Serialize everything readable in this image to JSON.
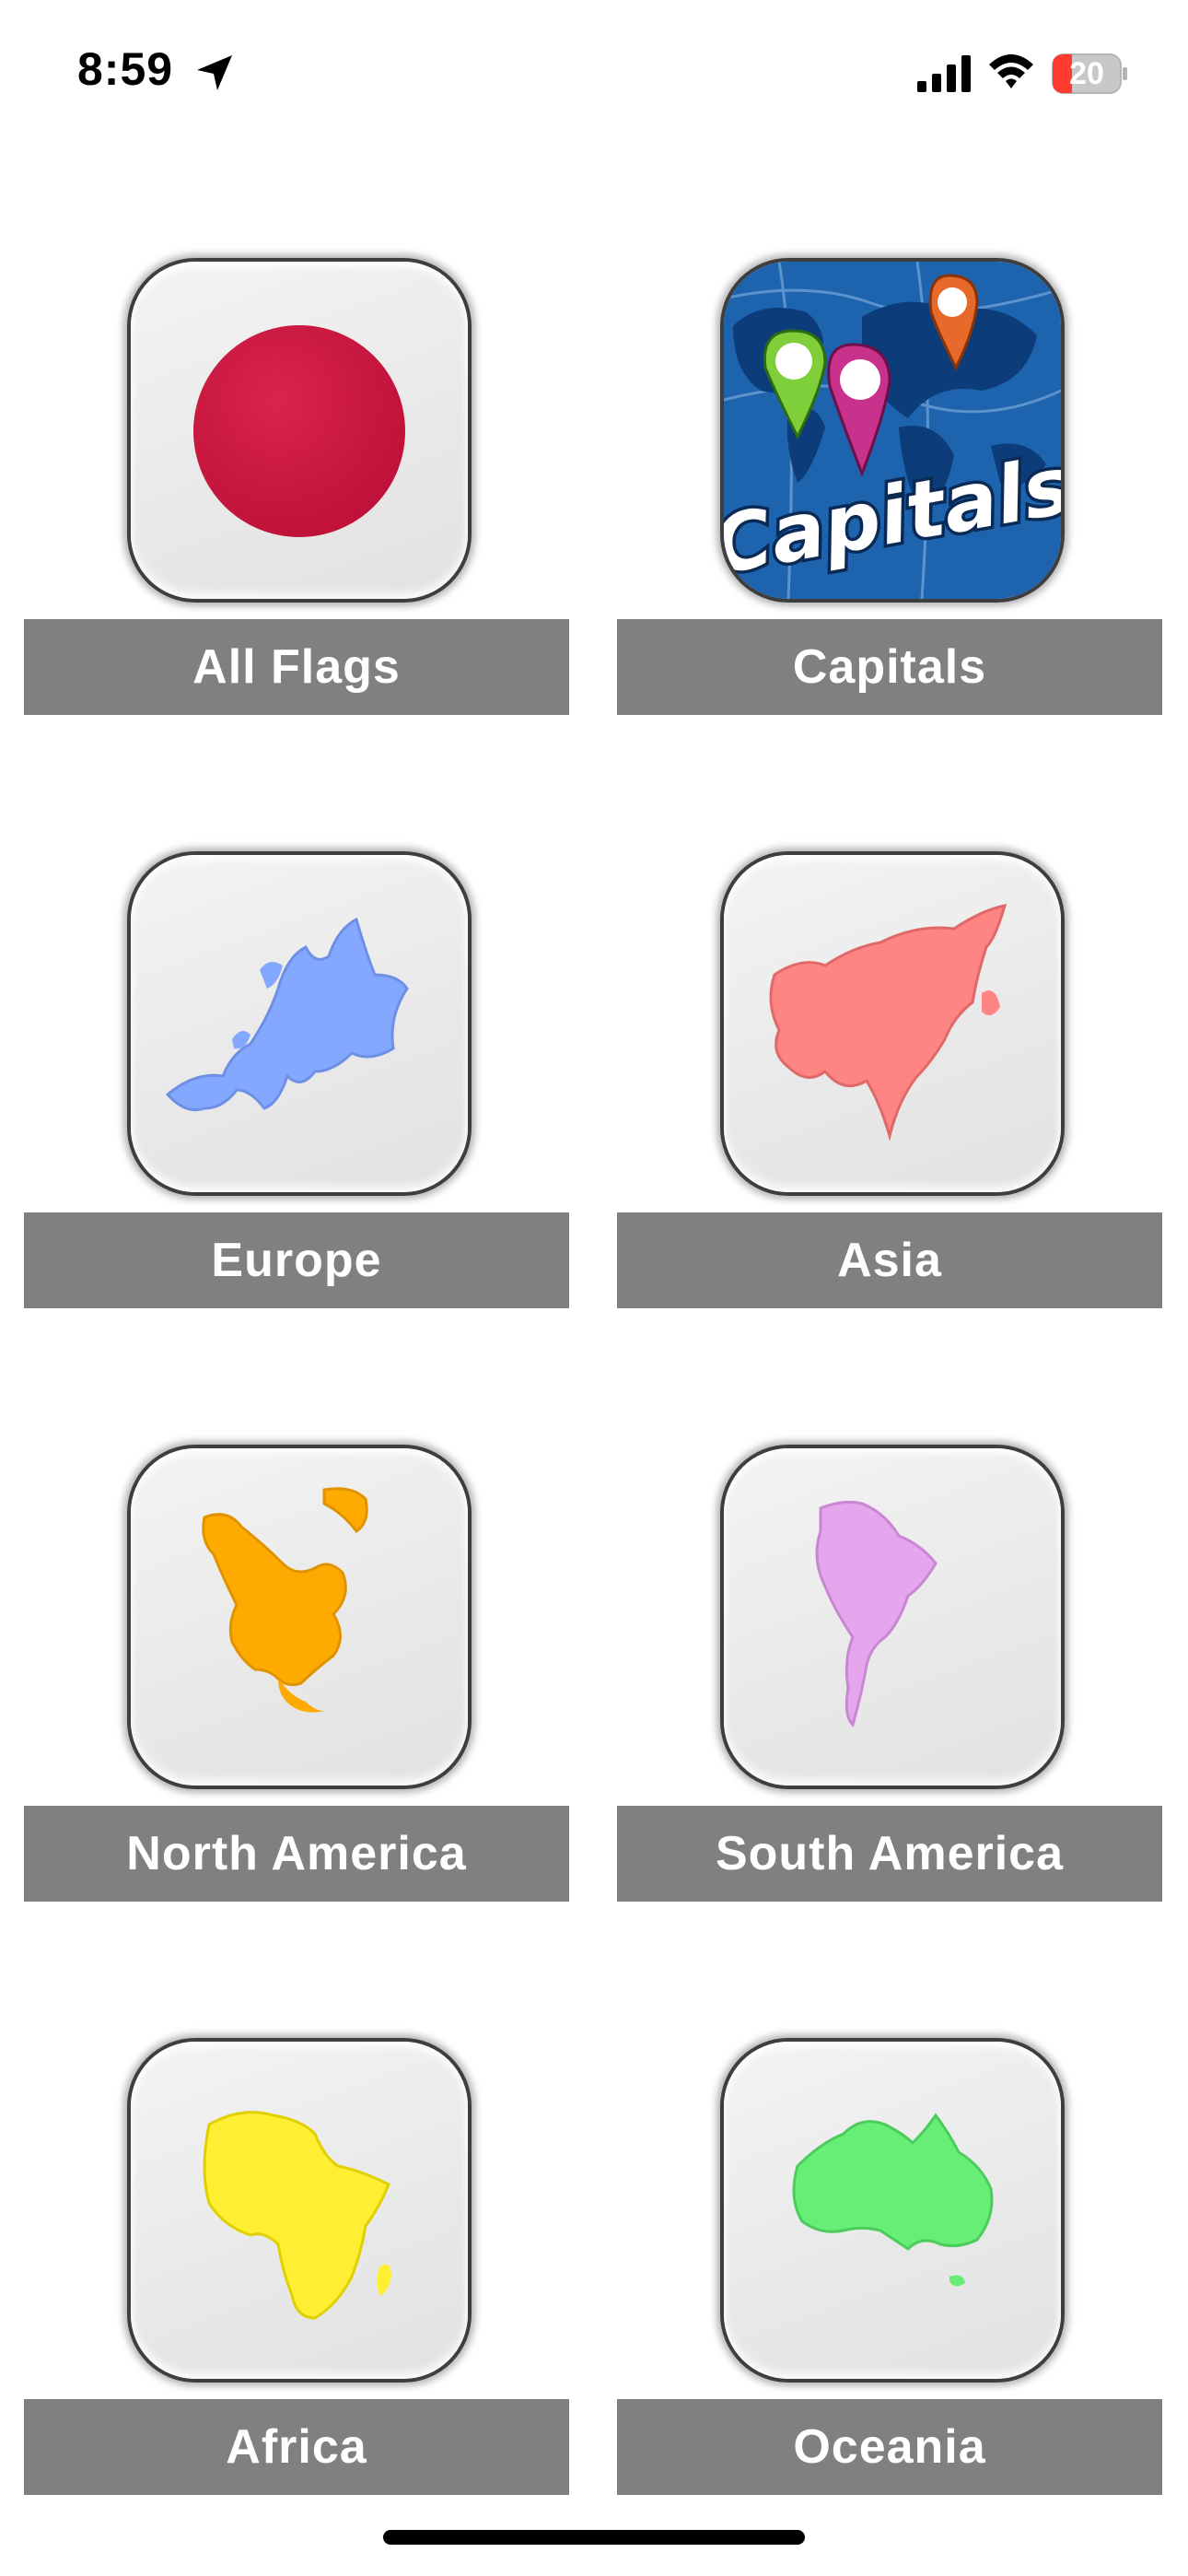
{
  "status_bar": {
    "time": "8:59",
    "battery_level": "20",
    "icons": [
      "location-arrow-icon",
      "cellular-signal-icon",
      "wifi-icon",
      "battery-icon"
    ],
    "battery_color": "#ff3b30"
  },
  "categories": [
    {
      "label": "All Flags",
      "icon": "japan-flag-icon",
      "color": "#c8163e"
    },
    {
      "label": "Capitals",
      "icon": "capitals-map-icon",
      "color": "#1b5ea6"
    },
    {
      "label": "Europe",
      "icon": "europe-map-icon",
      "color": "#85a8ff"
    },
    {
      "label": "Asia",
      "icon": "asia-map-icon",
      "color": "#ff8585"
    },
    {
      "label": "North America",
      "icon": "north-america-map-icon",
      "color": "#ffaa00"
    },
    {
      "label": "South America",
      "icon": "south-america-map-icon",
      "color": "#e6a6ee"
    },
    {
      "label": "Africa",
      "icon": "africa-map-icon",
      "color": "#ffef33"
    },
    {
      "label": "Oceania",
      "icon": "oceania-map-icon",
      "color": "#66ee77"
    }
  ],
  "capitals_icon_text": "Capitals",
  "colors": {
    "label_bar": "#808080",
    "label_text": "#ffffff",
    "background": "#ffffff"
  }
}
